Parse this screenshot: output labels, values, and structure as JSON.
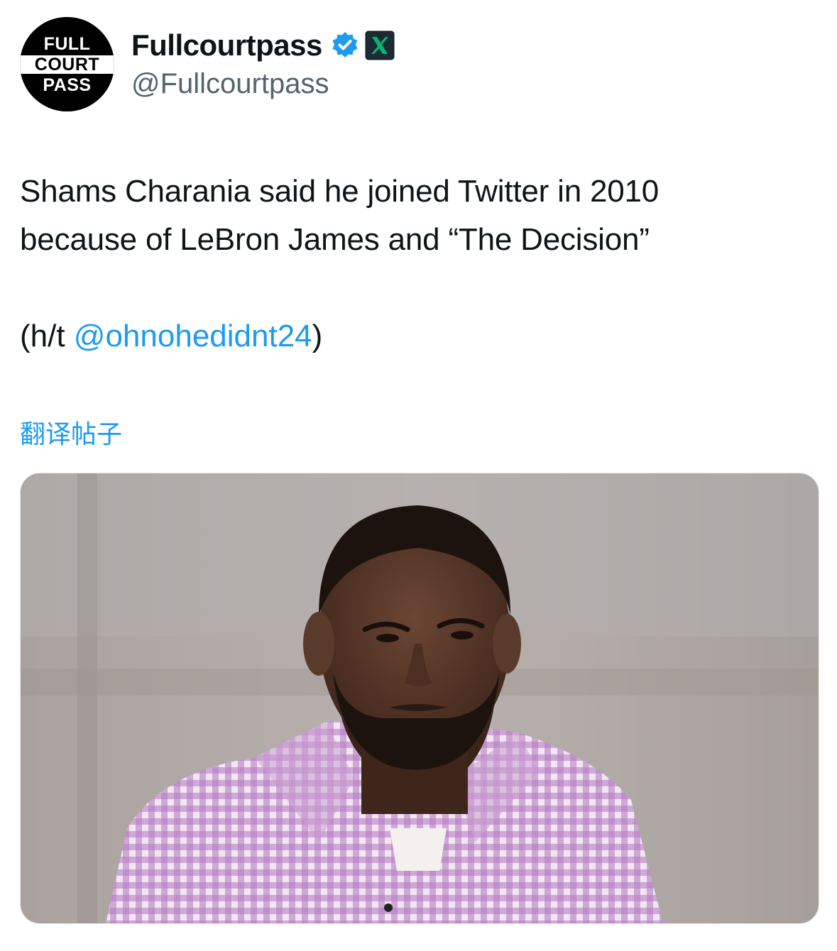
{
  "author": {
    "avatar_lines": [
      "FULL",
      "COURT",
      "PASS"
    ],
    "display_name": "Fullcourtpass",
    "handle": "@Fullcourtpass",
    "verified_icon": "verified-badge-icon",
    "affiliate_icon": "x-logo-icon"
  },
  "post": {
    "line1": "Shams Charania said he joined Twitter in 2010",
    "line2": "because of LeBron James and “The Decision”",
    "ht_prefix": "(h/t ",
    "ht_mention": "@ohnohedidnt24",
    "ht_suffix": ")",
    "translate_label": "翻译帖子"
  },
  "colors": {
    "link": "#1d9bf0",
    "secondary_text": "#536471",
    "verified": "#1d9bf0",
    "affiliate_badge": "#00b67a"
  }
}
